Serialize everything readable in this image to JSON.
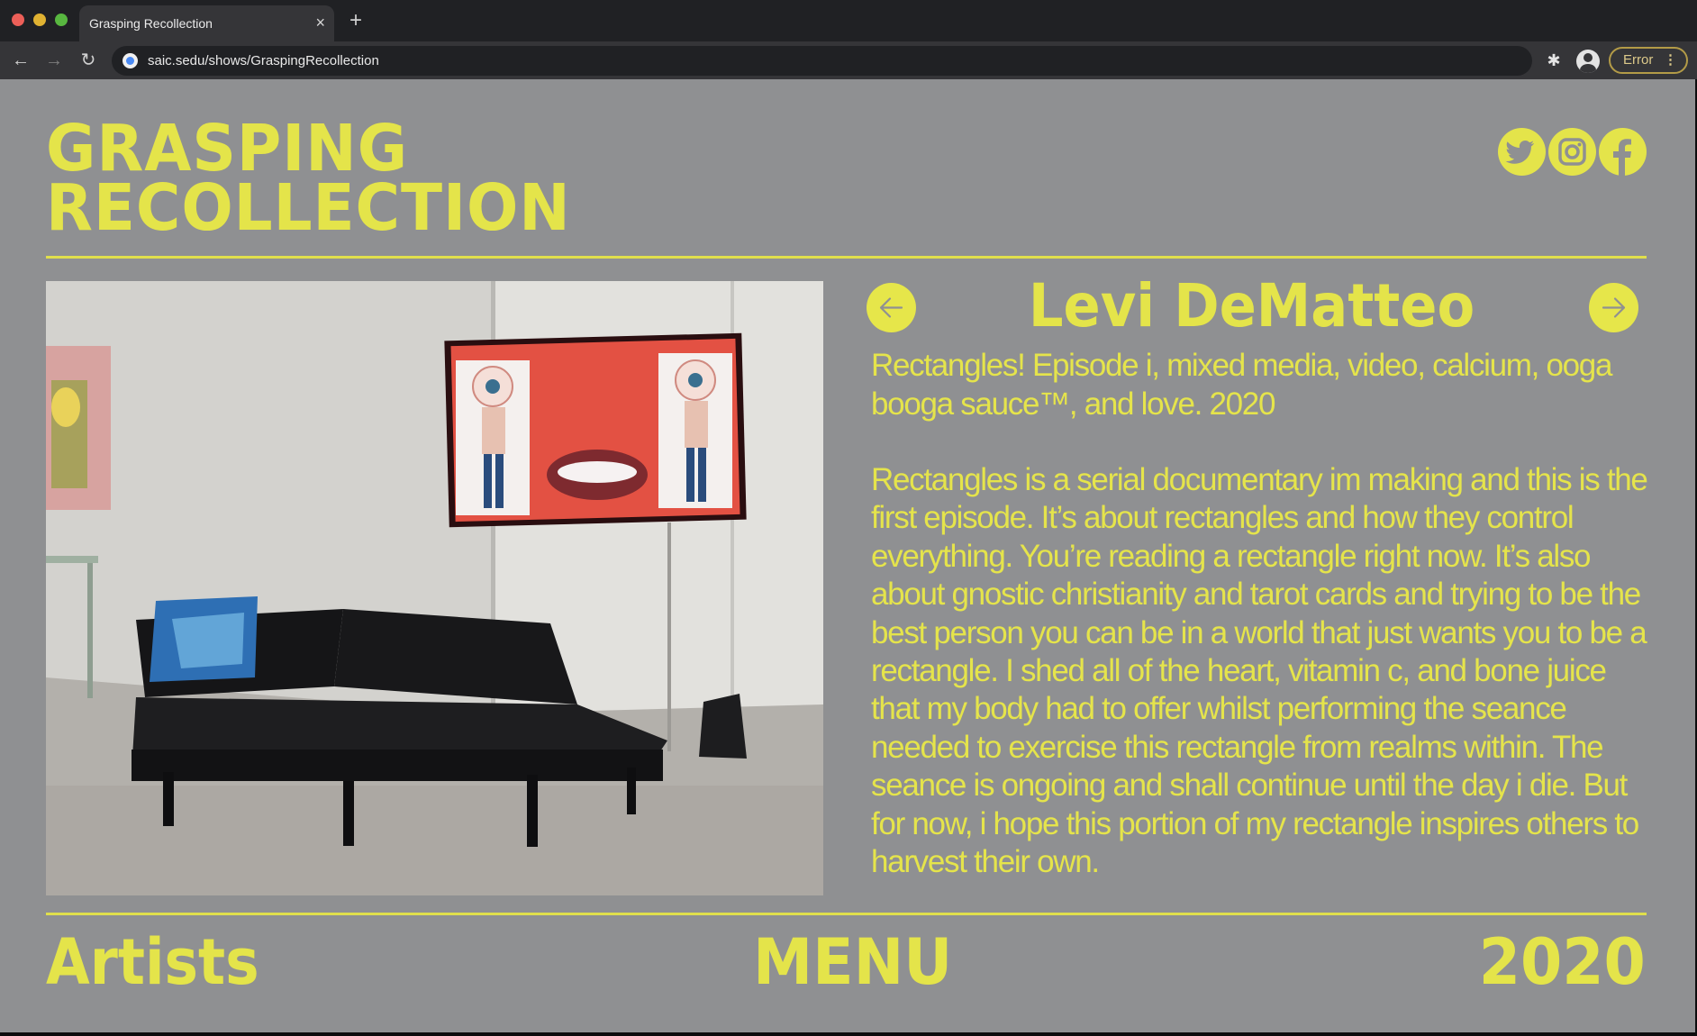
{
  "browser": {
    "tab_title": "Grasping Recollection",
    "tab_close": "×",
    "new_tab": "+",
    "back": "←",
    "forward": "→",
    "reload": "↻",
    "url": "saic.sedu/shows/GraspingRecollection",
    "extensions_icon": "puzzle-icon",
    "error_label": "Error",
    "kebab": "⋮"
  },
  "site": {
    "title": "GRASPING\nRECOLLECTION",
    "social": [
      {
        "name": "twitter-icon"
      },
      {
        "name": "instagram-icon"
      },
      {
        "name": "facebook-icon"
      }
    ]
  },
  "artist": {
    "name": "Levi DeMatteo",
    "work_info": "Rectangles! Episode i, mixed media, video, calcium, ooga booga sauce™, and love. 2020",
    "description": "Rectangles is a serial documentary im making and this is the first episode. It’s about rectangles and how they control everything. You’re reading a rectangle right now. It’s also about gnostic christianity and tarot cards and trying to be the best person you can be in a world that just wants you to be a rectangle. I shed all of the heart, vitamin c, and bone juice that my body had to offer whilst performing the seance needed to exercise this rectangle from realms within. The seance is ongoing and shall continue until the day i die. But for now, i hope this portion of my rectangle inspires others to harvest their own."
  },
  "footer": {
    "artists": "Artists",
    "menu": "MENU",
    "year": "2020"
  },
  "colors": {
    "accent": "#e4e44a",
    "page_bg": "#8f9092"
  }
}
